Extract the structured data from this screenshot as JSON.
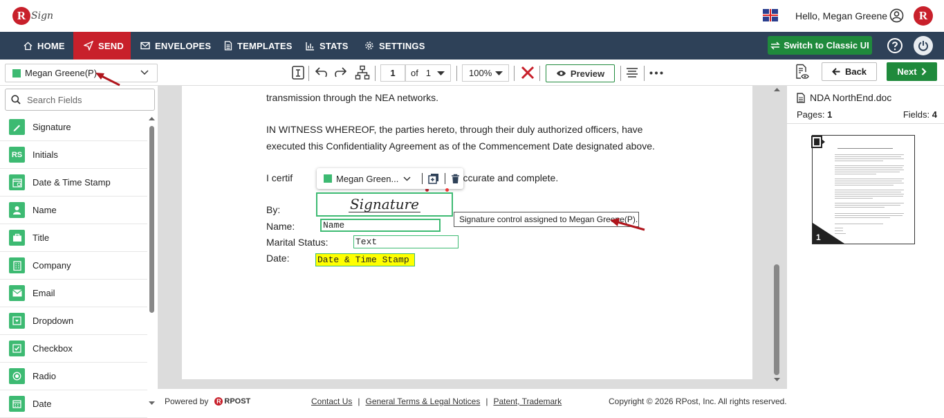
{
  "app": {
    "logo_text": "Sign",
    "logo_letter": "R"
  },
  "header": {
    "greeting": "Hello, Megan Greene",
    "avatar_letter": "R"
  },
  "nav": {
    "items": [
      {
        "label": "HOME",
        "icon": "home-icon"
      },
      {
        "label": "SEND",
        "icon": "send-icon",
        "active": true
      },
      {
        "label": "ENVELOPES",
        "icon": "envelope-icon"
      },
      {
        "label": "TEMPLATES",
        "icon": "document-icon"
      },
      {
        "label": "STATS",
        "icon": "bar-chart-icon"
      },
      {
        "label": "SETTINGS",
        "icon": "gear-icon"
      }
    ],
    "classic_button": "Switch to Classic UI"
  },
  "toolbar": {
    "recipient": "Megan Greene(P)",
    "page_current": "1",
    "page_of": "of",
    "page_total": "1",
    "zoom": "100%",
    "preview_label": "Preview",
    "back_label": "Back",
    "next_label": "Next"
  },
  "left_panel": {
    "search_placeholder": "Search Fields",
    "fields": [
      {
        "label": "Signature",
        "icon": "pen-icon"
      },
      {
        "label": "Initials",
        "icon": "initials-icon"
      },
      {
        "label": "Date & Time Stamp",
        "icon": "calendar-clock-icon"
      },
      {
        "label": "Name",
        "icon": "person-icon"
      },
      {
        "label": "Title",
        "icon": "briefcase-icon"
      },
      {
        "label": "Company",
        "icon": "building-icon"
      },
      {
        "label": "Email",
        "icon": "mail-icon"
      },
      {
        "label": "Dropdown",
        "icon": "dropdown-icon"
      },
      {
        "label": "Checkbox",
        "icon": "checkbox-icon"
      },
      {
        "label": "Radio",
        "icon": "radio-icon"
      },
      {
        "label": "Date",
        "icon": "calendar-icon"
      }
    ]
  },
  "document": {
    "line1": "transmission through the NEA networks.",
    "line2": "IN WITNESS WHEREOF, the parties hereto, through their duly authorized officers, have",
    "line3": "executed this Confidentiality Agreement as of the Commencement Date designated above.",
    "line4_start": "I certif",
    "line4_end": "ve is accurate and complete.",
    "by_label": "By:",
    "name_label": "Name:",
    "marital_label": "Marital Status:",
    "date_label": "Date:",
    "signature_field": "Signature",
    "name_field": "Name",
    "text_field": "Text",
    "date_field": "Date & Time Stamp",
    "popover_recipient": "Megan Green...",
    "tooltip": "Signature control assigned to Megan Greene(P)."
  },
  "footer": {
    "powered_by": "Powered by",
    "brand": "RPOST",
    "contact": "Contact Us",
    "terms": "General Terms & Legal Notices",
    "patent": "Patent, Trademark",
    "copyright": "Copyright © 2026 RPost, Inc. All rights reserved."
  },
  "right_panel": {
    "doc_name": "NDA NorthEnd.doc",
    "pages_label": "Pages:",
    "pages_value": "1",
    "fields_label": "Fields:",
    "fields_value": "4",
    "thumb_page": "1"
  },
  "colors": {
    "nav_bg": "#2e4158",
    "accent_red": "#c8202b",
    "accent_green": "#1f8a3c",
    "field_green": "#3dba72",
    "highlight": "#ffff00"
  }
}
